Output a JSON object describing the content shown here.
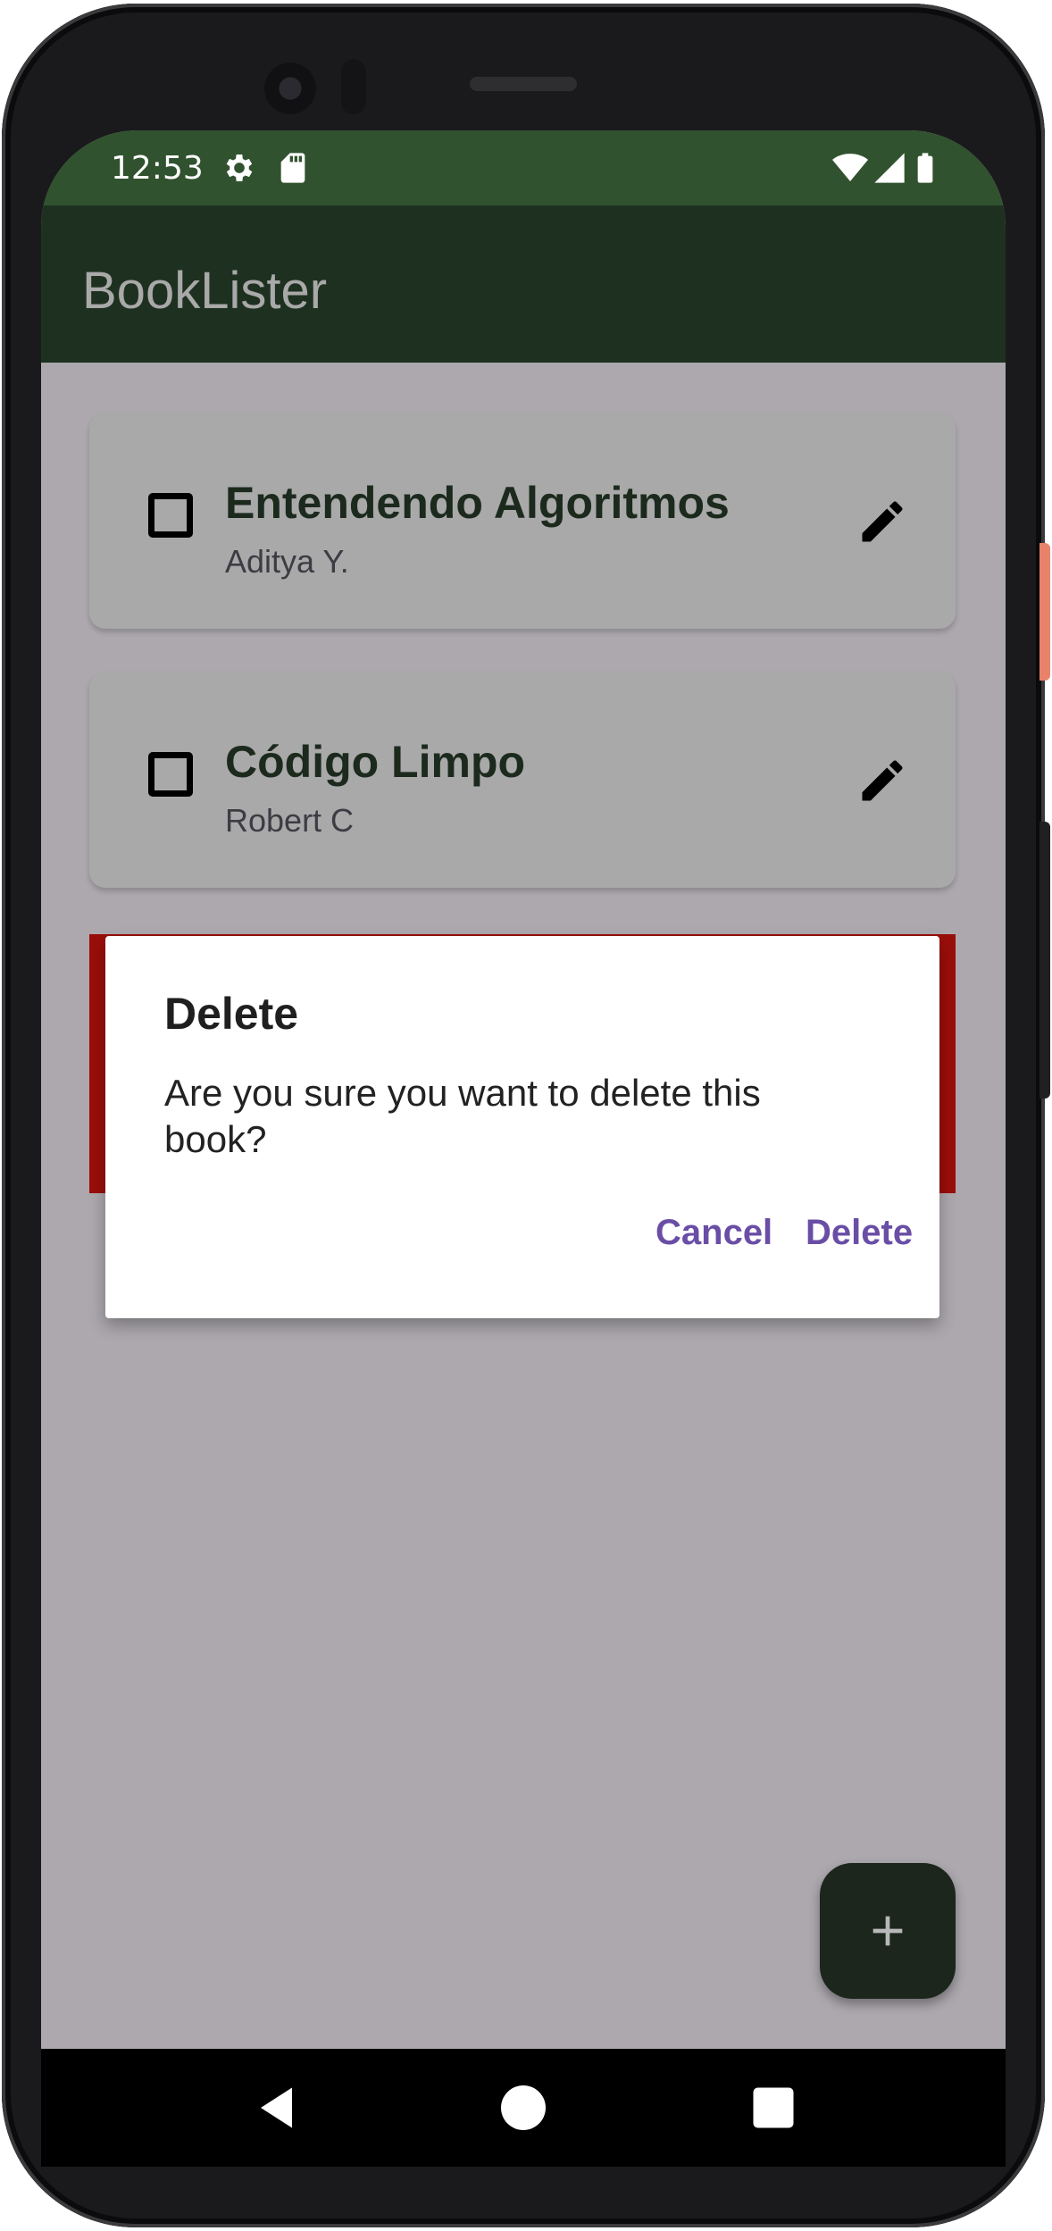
{
  "status_bar": {
    "time": "12:53",
    "icons": [
      "gear-icon",
      "sd-card-icon",
      "wifi-icon",
      "signal-icon",
      "battery-icon"
    ]
  },
  "app_bar": {
    "title": "BookLister"
  },
  "books": [
    {
      "title": "Entendendo Algoritmos",
      "author": "Aditya Y.",
      "checked": false
    },
    {
      "title": "Código Limpo",
      "author": "Robert C",
      "checked": false
    }
  ],
  "dialog": {
    "title": "Delete",
    "message": "Are you sure you want to delete this book?",
    "cancel_label": "Cancel",
    "confirm_label": "Delete"
  },
  "fab": {
    "icon": "plus-icon"
  },
  "navigation": {
    "icons": [
      "back-icon",
      "home-icon",
      "recents-icon"
    ]
  },
  "colors": {
    "status_bar": "#31522f",
    "app_bar": "#1e3120",
    "scrim": "#aca8ae",
    "delete_swipe": "#9a0e0a",
    "dialog_action": "#6a4ea6",
    "fab": "#1c261c"
  }
}
